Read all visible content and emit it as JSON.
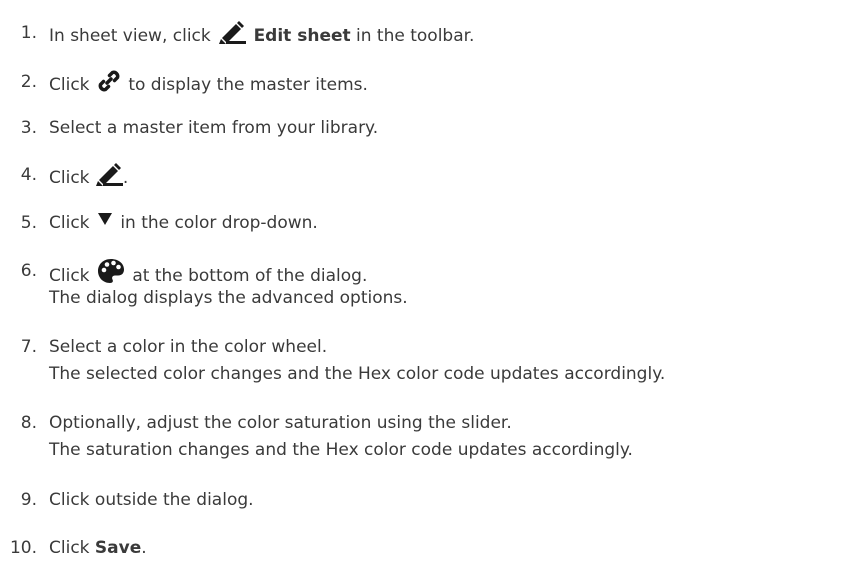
{
  "steps": [
    {
      "num": "1.",
      "pre": "In sheet view, click ",
      "icon": "pencil-icon",
      "bold": "Edit sheet",
      "post": " in the toolbar."
    },
    {
      "num": "2.",
      "pre": "Click ",
      "icon": "link-icon",
      "post": " to display the master items."
    },
    {
      "num": "3.",
      "text": "Select a master item from your library."
    },
    {
      "num": "4.",
      "pre": "Click ",
      "icon": "pencil-icon",
      "post": "."
    },
    {
      "num": "5.",
      "pre": "Click ",
      "icon": "triangle-down-icon",
      "post": " in the color drop-down."
    },
    {
      "num": "6.",
      "pre": "Click ",
      "icon": "palette-icon",
      "post": " at the bottom of the dialog.",
      "sub": "The dialog displays the advanced options."
    },
    {
      "num": "7.",
      "text": "Select a color in the color wheel.",
      "sub": "The selected color changes and the Hex color code updates accordingly."
    },
    {
      "num": "8.",
      "text": "Optionally, adjust the color saturation using the slider.",
      "sub": "The saturation changes and the Hex color code updates accordingly."
    },
    {
      "num": "9.",
      "text": "Click outside the dialog."
    },
    {
      "num": "10.",
      "pre": "Click ",
      "bold": "Save",
      "post": "."
    }
  ]
}
